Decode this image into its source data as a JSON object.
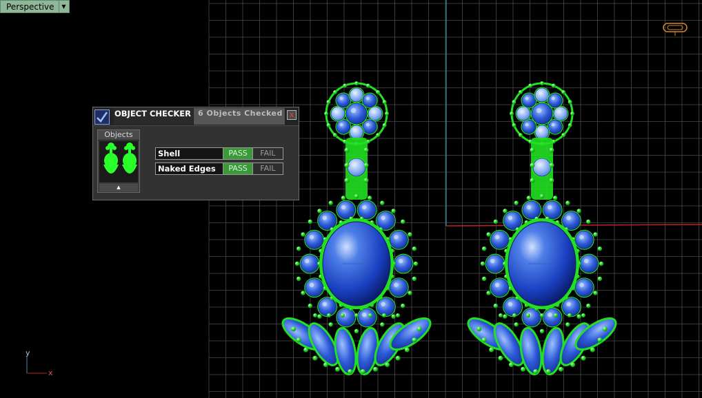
{
  "viewport": {
    "name": "Perspective",
    "grid_color": "#4a4a4a",
    "axis_y_color": "#3a8fb0",
    "axis_x_color": "#c0241e"
  },
  "axes_indicator": {
    "y": "y",
    "x": "x"
  },
  "object_checker": {
    "title": "OBJECT CHECKER",
    "status": "6  Objects Checked",
    "close_glyph": "x",
    "objects_header": "Objects",
    "collapse_glyph": "▲",
    "checks": [
      {
        "name": "Shell",
        "pass_label": "PASS",
        "fail_label": "FAIL",
        "result": "pass"
      },
      {
        "name": "Naked Edges",
        "pass_label": "PASS",
        "fail_label": "FAIL",
        "result": "pass"
      }
    ]
  },
  "colors": {
    "metal": "#22e022",
    "gem_blue": "#1a3fbf",
    "gem_light": "#6fa0ff",
    "pass": "#3a9a3a"
  }
}
